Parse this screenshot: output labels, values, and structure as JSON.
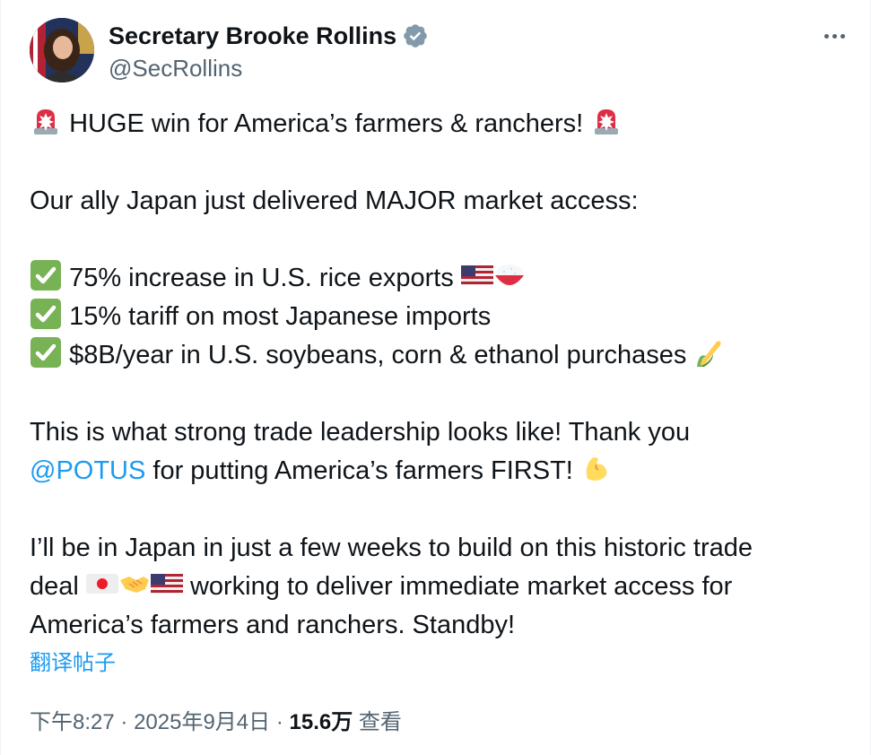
{
  "author": {
    "display_name": "Secretary Brooke Rollins",
    "handle": "@SecRollins"
  },
  "icons": {
    "verified": "verified-badge-icon",
    "more": "more-options-icon",
    "siren": "siren-emoji",
    "check": "check-mark-emoji",
    "us_flag": "us-flag-emoji",
    "rice": "rice-bowl-emoji",
    "corn": "corn-emoji",
    "muscle": "flexed-biceps-emoji",
    "japan_flag": "japan-flag-emoji",
    "handshake": "handshake-emoji"
  },
  "tweet": {
    "line1": "HUGE win for America’s farmers & ranchers!",
    "line2": "Our ally Japan just delivered MAJOR market access:",
    "bullet1": "75% increase in U.S. rice exports",
    "bullet2": "15% tariff on most Japanese imports",
    "bullet3": "$8B/year in U.S. soybeans, corn & ethanol purchases",
    "line3": "This is what strong trade leadership looks like! Thank you",
    "mention": "@POTUS",
    "line4_rest": "for putting America’s farmers FIRST!",
    "line5": "I’ll be in Japan in just a few weeks to build on this historic trade",
    "line6_start": "deal",
    "line6_rest": "working to deliver immediate market access for",
    "line7": "America’s farmers and ranchers. Standby!"
  },
  "translate_label": "翻译帖子",
  "meta": {
    "time": "下午8:27",
    "sep1": "·",
    "date": "2025年9月4日",
    "sep2": "·",
    "views": "15.6万",
    "views_label": "查看"
  },
  "colors": {
    "link": "#1d9bf0",
    "secondary_text": "#536471",
    "verified": "#829aab"
  }
}
